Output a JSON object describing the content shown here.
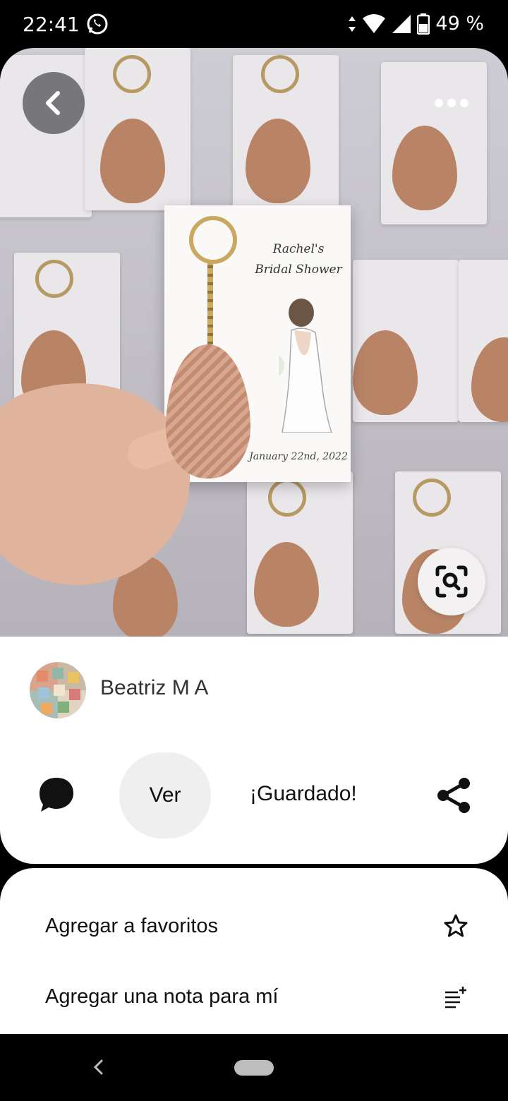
{
  "status_bar": {
    "time": "22:41",
    "battery": "49 %",
    "icons": [
      "whatsapp-icon",
      "data-arrows-icon",
      "wifi-icon",
      "signal-icon",
      "battery-icon"
    ]
  },
  "photo": {
    "card_title_line1": "Rachel's",
    "card_title_line2": "Bridal Shower",
    "card_date": "January 22nd, 2022"
  },
  "author": {
    "name": "Beatriz M A"
  },
  "actions": {
    "view_label": "Ver",
    "saved_label": "¡Guardado!"
  },
  "menu": {
    "items": [
      {
        "label": "Agregar a favoritos",
        "icon": "star-icon"
      },
      {
        "label": "Agregar una nota para mí",
        "icon": "add-note-icon"
      }
    ]
  },
  "colors": {
    "background": "#000000",
    "panel": "#ffffff",
    "ver_button_bg": "#efefef"
  }
}
